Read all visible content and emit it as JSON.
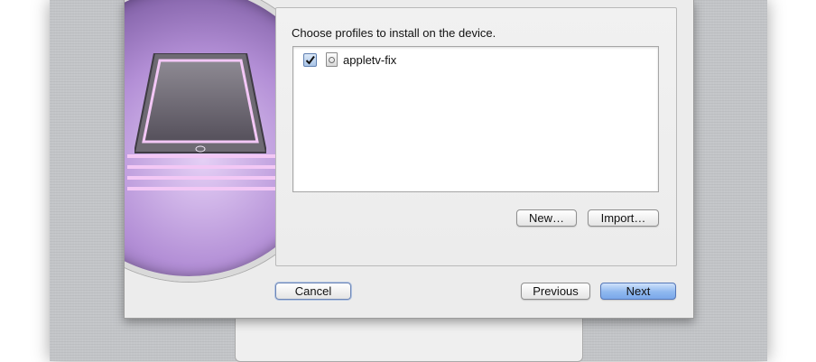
{
  "panel": {
    "prompt": "Choose profiles to install on the device."
  },
  "profiles": [
    {
      "name": "appletv-fix",
      "checked": true,
      "icon": "profile-document-icon"
    }
  ],
  "buttons": {
    "new": "New…",
    "import": "Import…",
    "cancel": "Cancel",
    "previous": "Previous",
    "next": "Next"
  },
  "colors": {
    "accent": "#7aa8ea",
    "artwork_purple": "#b38fd6"
  }
}
